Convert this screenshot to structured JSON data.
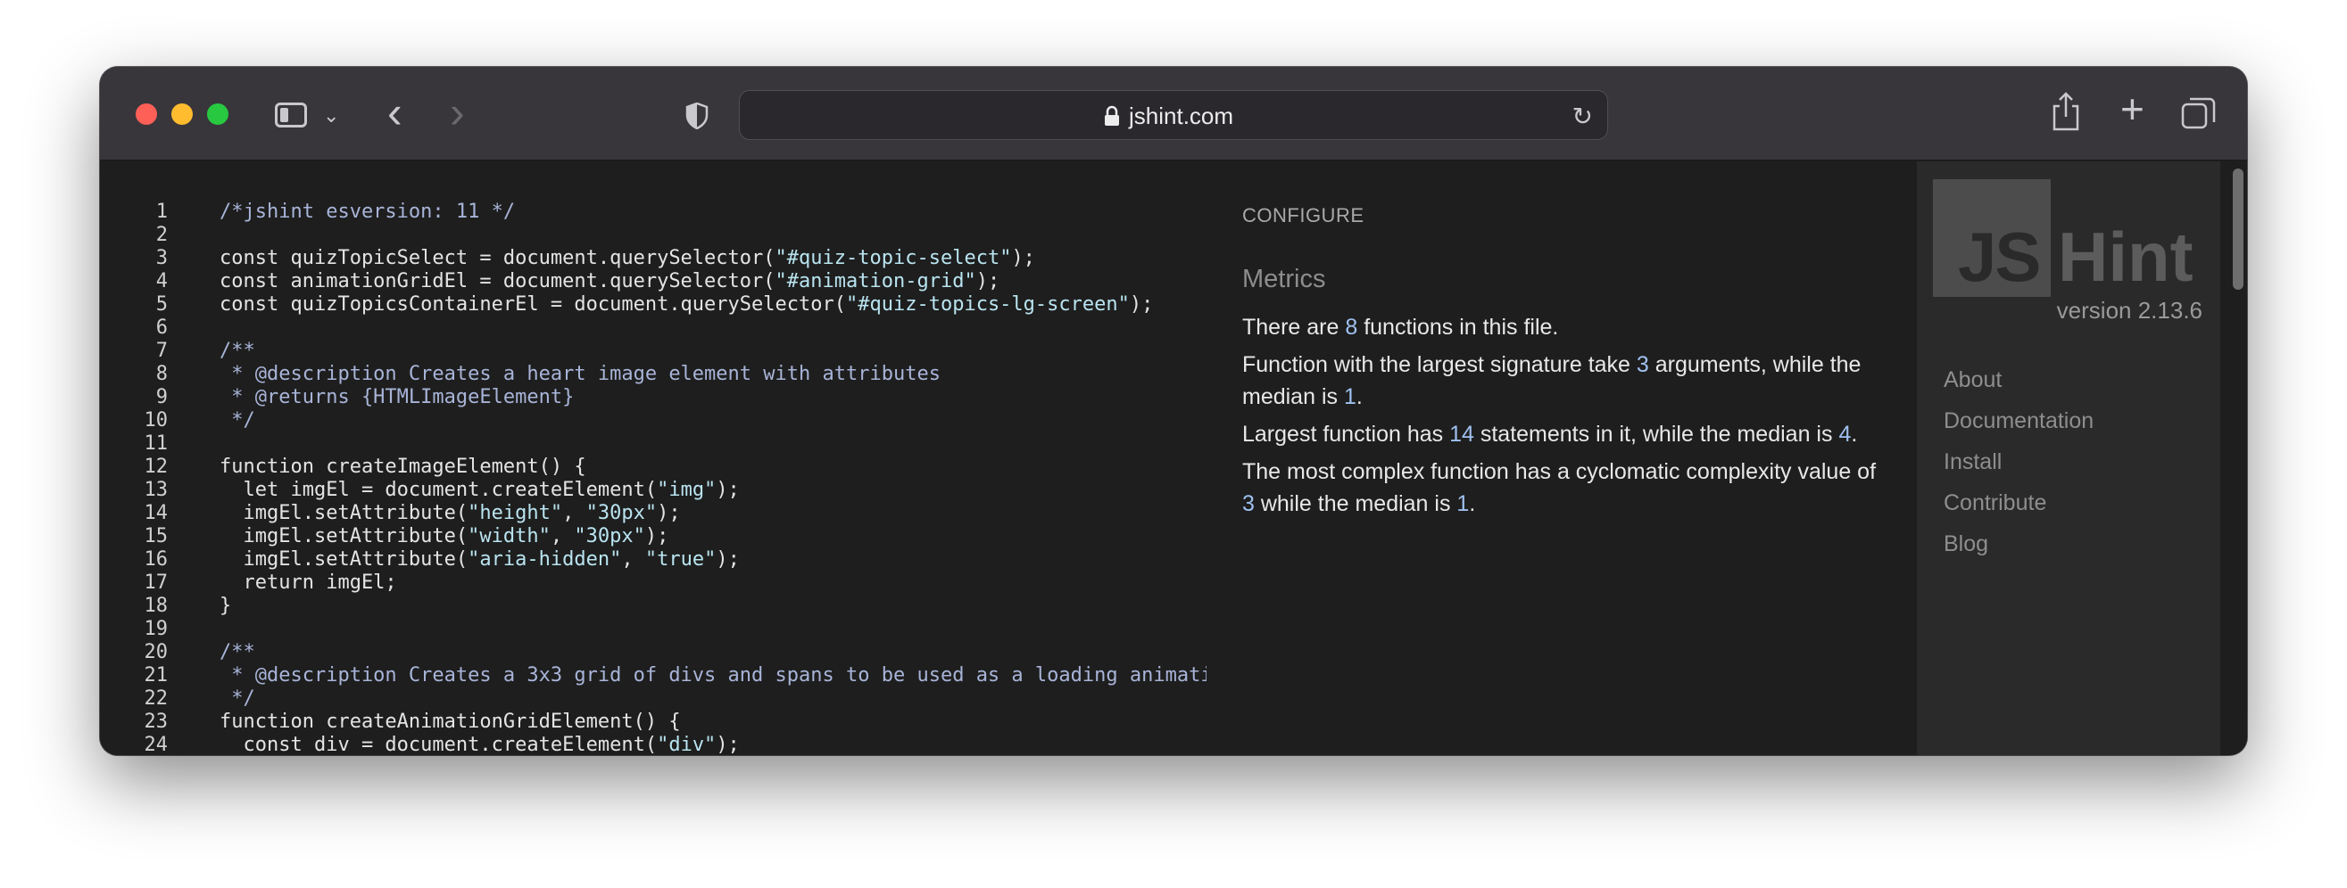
{
  "browser": {
    "url": "jshint.com",
    "icons": {
      "sidebar": "sidebar-icon",
      "back": "back-arrow-icon",
      "forward": "forward-arrow-icon",
      "privacy": "shield-icon",
      "lock": "lock-icon",
      "reload": "reload-icon",
      "share": "share-icon",
      "new_tab": "plus-icon",
      "tabs": "tabs-icon"
    },
    "glyphs": {
      "back": "‹",
      "forward": "›",
      "chevron": "⌄",
      "reload": "↻",
      "new_tab": "+"
    }
  },
  "editor": {
    "lines": [
      {
        "n": "1",
        "text": "/*jshint esversion: 11 */"
      },
      {
        "n": "2",
        "text": ""
      },
      {
        "n": "3",
        "text": "const quizTopicSelect = document.querySelector(\"#quiz-topic-select\");"
      },
      {
        "n": "4",
        "text": "const animationGridEl = document.querySelector(\"#animation-grid\");"
      },
      {
        "n": "5",
        "text": "const quizTopicsContainerEl = document.querySelector(\"#quiz-topics-lg-screen\");"
      },
      {
        "n": "6",
        "text": ""
      },
      {
        "n": "7",
        "text": "/**"
      },
      {
        "n": "8",
        "text": " * @description Creates a heart image element with attributes"
      },
      {
        "n": "9",
        "text": " * @returns {HTMLImageElement}"
      },
      {
        "n": "10",
        "text": " */"
      },
      {
        "n": "11",
        "text": ""
      },
      {
        "n": "12",
        "text": "function createImageElement() {"
      },
      {
        "n": "13",
        "text": "  let imgEl = document.createElement(\"img\");"
      },
      {
        "n": "14",
        "text": "  imgEl.setAttribute(\"height\", \"30px\");"
      },
      {
        "n": "15",
        "text": "  imgEl.setAttribute(\"width\", \"30px\");"
      },
      {
        "n": "16",
        "text": "  imgEl.setAttribute(\"aria-hidden\", \"true\");"
      },
      {
        "n": "17",
        "text": "  return imgEl;"
      },
      {
        "n": "18",
        "text": "}"
      },
      {
        "n": "19",
        "text": ""
      },
      {
        "n": "20",
        "text": "/**"
      },
      {
        "n": "21",
        "text": " * @description Creates a 3x3 grid of divs and spans to be used as a loading animati"
      },
      {
        "n": "22",
        "text": " */"
      },
      {
        "n": "23",
        "text": "function createAnimationGridElement() {"
      },
      {
        "n": "24",
        "text": "  const div = document.createElement(\"div\");"
      }
    ]
  },
  "configure": {
    "label": "CONFIGURE",
    "metrics_title": "Metrics",
    "m1": {
      "a": "There are ",
      "n": "8",
      "b": " functions in this file."
    },
    "m2": {
      "a": "Function with the largest signature take ",
      "n1": "3",
      "b": " arguments, while the median is ",
      "n2": "1",
      "c": "."
    },
    "m3": {
      "a": "Largest function has ",
      "n1": "14",
      "b": " statements in it, while the median is ",
      "n2": "4",
      "c": "."
    },
    "m4": {
      "a": "The most complex function has a cyclomatic complexity value of ",
      "n1": "3",
      "b": " while the median is ",
      "n2": "1",
      "c": "."
    }
  },
  "sidebar": {
    "logo_js": "JS",
    "logo_hint": "Hint",
    "version": "version 2.13.6",
    "nav": [
      "About",
      "Documentation",
      "Install",
      "Contribute",
      "Blog"
    ]
  }
}
